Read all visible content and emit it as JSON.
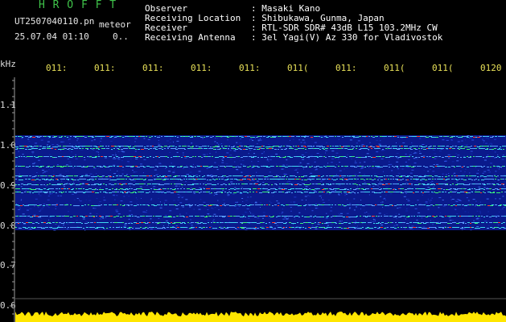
{
  "header": {
    "logo": "H R O F F T",
    "filename": "UT2507040110.pn",
    "filename_suffix": "meteor",
    "datetime": "25.07.04 01:10",
    "datetime_suffix": "0.."
  },
  "info": [
    {
      "label": "Observer",
      "value": ": Masaki Kano"
    },
    {
      "label": "Receiving Location",
      "value": ": Shibukawa, Gunma, Japan"
    },
    {
      "label": "Receiver",
      "value": ": RTL-SDR SDR# 43dB L15 103.2MHz CW"
    },
    {
      "label": "Receiving Antenna",
      "value": ": 3el Yagi(V) Az 330 for Vladivostok"
    }
  ],
  "axis": {
    "unit": "kHz",
    "y_ticks": [
      "1.1",
      "1.0",
      "0.9",
      "0.8",
      "0.7",
      "0.6"
    ],
    "x_ticks": [
      "011:",
      "011:",
      "011:",
      "011:",
      "011:",
      "011(",
      "011:",
      "011(",
      "011(",
      "0120"
    ]
  },
  "colors": {
    "background": "#000000",
    "spectrum_base": "#0a1a8c",
    "signal": "#ffe600",
    "logo": "#3fc34a",
    "tick_labels": "#e8e058"
  }
}
